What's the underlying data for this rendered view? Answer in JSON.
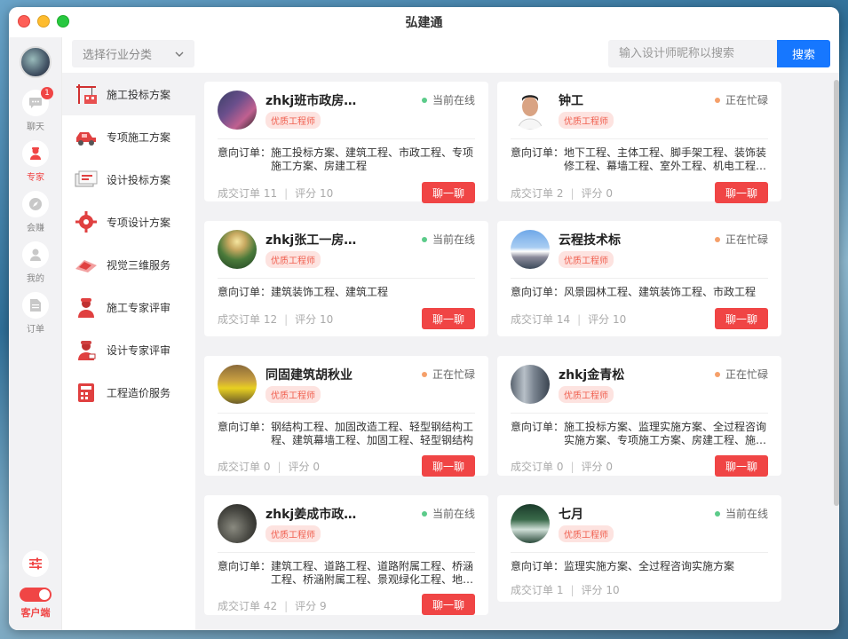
{
  "app": {
    "title": "弘建通"
  },
  "rail": {
    "items": [
      {
        "label": "聊天",
        "icon": "chat-icon",
        "badge": "1"
      },
      {
        "label": "专家",
        "icon": "expert-icon",
        "active": true
      },
      {
        "label": "会赚",
        "icon": "compass-icon"
      },
      {
        "label": "我的",
        "icon": "user-icon"
      },
      {
        "label": "订单",
        "icon": "order-icon"
      }
    ],
    "client_label": "客户端"
  },
  "filter": {
    "select_label": "选择行业分类",
    "search_placeholder": "输入设计师昵称以搜索",
    "search_button": "搜索"
  },
  "categories": [
    {
      "label": "施工投标方案",
      "icon": "crane-icon"
    },
    {
      "label": "专项施工方案",
      "icon": "vehicle-icon"
    },
    {
      "label": "设计投标方案",
      "icon": "blueprint-icon"
    },
    {
      "label": "专项设计方案",
      "icon": "gear-icon"
    },
    {
      "label": "视觉三维服务",
      "icon": "3d-icon"
    },
    {
      "label": "施工专家评审",
      "icon": "worker-icon"
    },
    {
      "label": "设计专家评审",
      "icon": "designer-icon"
    },
    {
      "label": "工程造价服务",
      "icon": "calculator-icon"
    }
  ],
  "labels": {
    "quality_tag": "优质工程师",
    "intent_prefix": "意向订单：",
    "orders_prefix": "成交订单",
    "score_prefix": "评分",
    "chat_button": "聊一聊"
  },
  "status_colors": {
    "online": "#5ccb8a",
    "busy": "#f5a06a"
  },
  "engineers": [
    {
      "name": "zhkj班市政房建标",
      "status": "当前在线",
      "status_type": "online",
      "intent": "施工投标方案、建筑工程、市政工程、专项施工方案、房建工程",
      "orders": "11",
      "score": "10",
      "show_chat": true
    },
    {
      "name": "钟工",
      "status": "正在忙碌",
      "status_type": "busy",
      "intent": "地下工程、主体工程、脚手架工程、装饰装修工程、幕墙工程、室外工程、机电工程、施工投标方案",
      "orders": "2",
      "score": "0",
      "show_chat": true
    },
    {
      "name": "zhkj张工一房建...",
      "status": "当前在线",
      "status_type": "online",
      "intent": "建筑装饰工程、建筑工程",
      "orders": "12",
      "score": "10",
      "show_chat": true
    },
    {
      "name": "云程技术标",
      "status": "正在忙碌",
      "status_type": "busy",
      "intent": "风景园林工程、建筑装饰工程、市政工程",
      "orders": "14",
      "score": "10",
      "show_chat": true
    },
    {
      "name": "同固建筑胡秋业",
      "status": "正在忙碌",
      "status_type": "busy",
      "intent": "钢结构工程、加固改造工程、轻型钢结构工程、建筑幕墙工程、加固工程、轻型钢结构",
      "orders": "0",
      "score": "0",
      "show_chat": true
    },
    {
      "name": "zhkj金青松",
      "status": "正在忙碌",
      "status_type": "busy",
      "intent": "施工投标方案、监理实施方案、全过程咨询实施方案、专项施工方案、房建工程、施工组织设计",
      "orders": "0",
      "score": "0",
      "show_chat": true
    },
    {
      "name": "zhkj姜成市政房...",
      "status": "当前在线",
      "status_type": "online",
      "intent": "建筑工程、道路工程、道路附属工程、桥涵工程、桥涵附属工程、景观绿化工程、地下管网",
      "orders": "42",
      "score": "9",
      "show_chat": true
    },
    {
      "name": "七月",
      "status": "当前在线",
      "status_type": "online",
      "intent": "监理实施方案、全过程咨询实施方案",
      "orders": "1",
      "score": "10",
      "show_chat": false
    }
  ]
}
